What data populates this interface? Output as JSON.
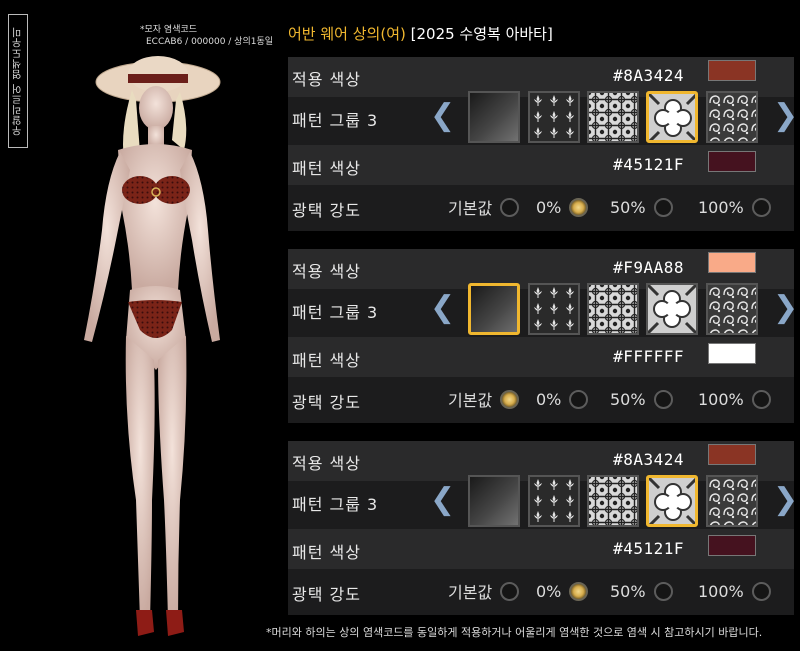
{
  "side_tag": "우알리르어 염색도우미",
  "hat_note": {
    "line1": "*모자 염색코드",
    "line2": "ECCAB6 / 000000 / 상의1동일"
  },
  "title": {
    "accent": "어반 웨어 상의(여)",
    "rest": "[2025 수영복 아바타]"
  },
  "labels": {
    "apply_color": "적용 색상",
    "pattern_group": "패턴 그룹 3",
    "pattern_color": "패턴 색상",
    "gloss": "광택 강도"
  },
  "gloss_options": [
    "기본값",
    "0%",
    "50%",
    "100%"
  ],
  "panels": [
    {
      "apply_hex": "#8A3424",
      "apply_color": "#8A3424",
      "pattern_hex": "#45121F",
      "pattern_color": "#45121F",
      "selected_pattern": 3,
      "gloss_selected": 1
    },
    {
      "apply_hex": "#F9AA88",
      "apply_color": "#F9AA88",
      "pattern_hex": "#FFFFFF",
      "pattern_color": "#FFFFFF",
      "selected_pattern": 0,
      "gloss_selected": 0
    },
    {
      "apply_hex": "#8A3424",
      "apply_color": "#8A3424",
      "pattern_hex": "#45121F",
      "pattern_color": "#45121F",
      "selected_pattern": 3,
      "gloss_selected": 1
    }
  ],
  "patterns": [
    "plain-gradient",
    "fleur-de-lis",
    "damask-grid",
    "quatrefoil",
    "paisley-swirl"
  ],
  "colors": {
    "accent": "#F0B72F",
    "arrow": "#8AA7C8",
    "panel_bg": "#1C1C1D",
    "row_bg": "#2A2A2B"
  },
  "footer": "*머리와 하의는 상의 염색코드를 동일하게 적용하거나 어울리게 염색한 것으로 염색 시 참고하시기 바랍니다."
}
